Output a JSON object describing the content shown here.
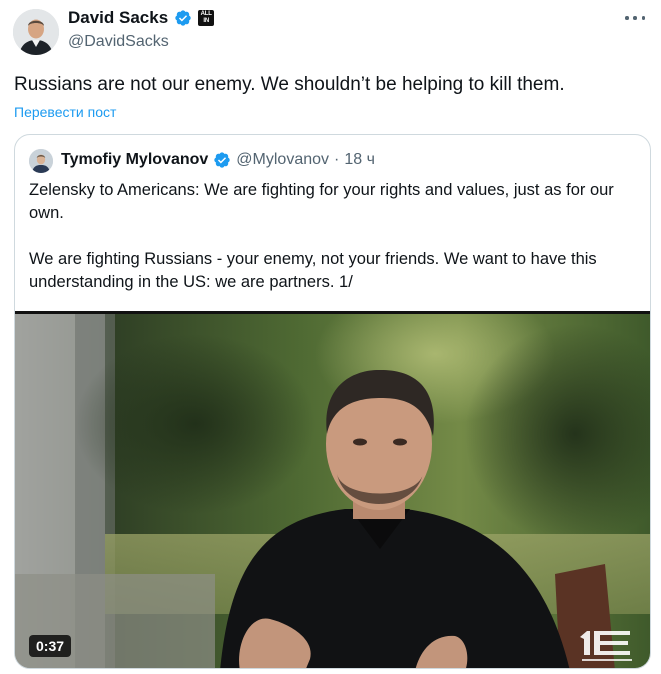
{
  "author": {
    "name": "David Sacks",
    "handle": "@DavidSacks",
    "affiliate_badge": [
      "ALL",
      "IN"
    ]
  },
  "tweet": {
    "text": "Russians are not our enemy. We shouldn’t be helping to kill them.",
    "translate_link": "Перевести пост"
  },
  "quoted": {
    "name": "Tymofiy Mylovanov",
    "handle": "@Mylovanov",
    "separator": "·",
    "time": "18 ч",
    "paragraphs": [
      "Zelensky to Americans: We are fighting for your rights and values, just as for our own.",
      "We are fighting Russians - your enemy, not your friends. We want to have this understanding in the US: we are partners. 1/"
    ],
    "video": {
      "duration": "0:37"
    }
  },
  "colors": {
    "link": "#1d9bf0",
    "secondary_text": "#536471",
    "verified": "#1d9bf0",
    "border": "#cfd9de"
  },
  "icons": [
    "verified-badge-icon",
    "more-options-icon",
    "video-watermark-logo"
  ]
}
